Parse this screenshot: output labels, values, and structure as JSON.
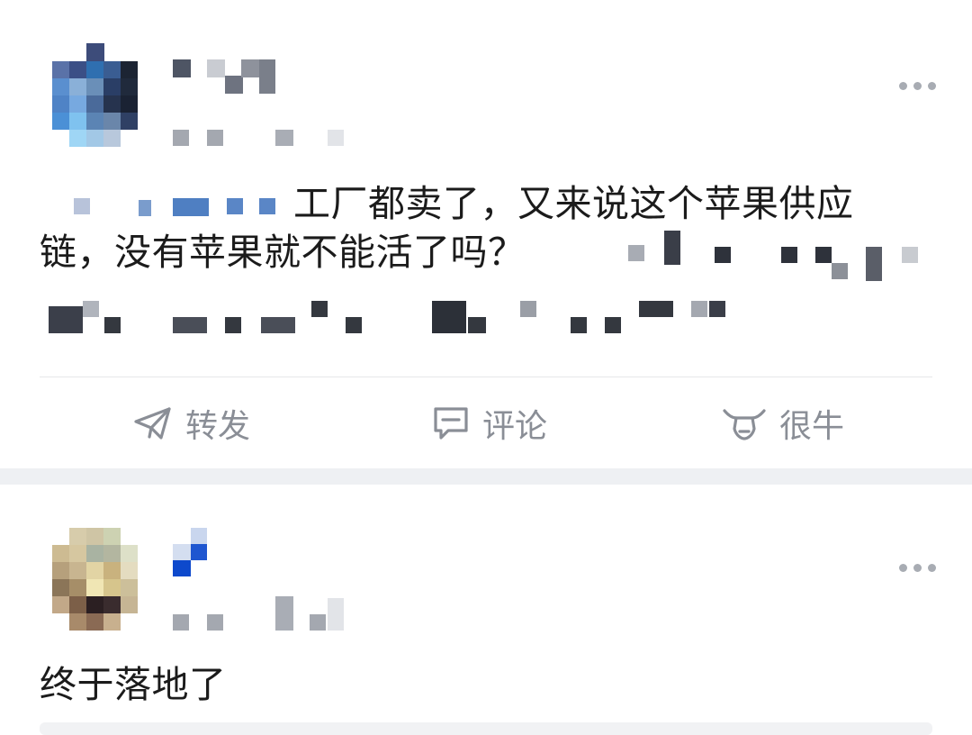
{
  "feed": {
    "posts": [
      {
        "author_name": "",
        "meta": "",
        "text_lines": [
          "工厂都卖了，又来说这个苹果供应",
          "链，没有苹果就不能活了吗？",
          ""
        ],
        "actions": {
          "repost": "转发",
          "comment": "评论",
          "like": "很牛"
        }
      },
      {
        "author_name": "",
        "meta": "",
        "text_lines": [
          "终于落地了"
        ]
      }
    ]
  },
  "colors": {
    "action_gray": "#8a8e96",
    "separator": "#eef0f3",
    "text": "#1b1b1b"
  },
  "icons": [
    "repost-icon",
    "comment-icon",
    "bull-icon",
    "more-icon"
  ]
}
